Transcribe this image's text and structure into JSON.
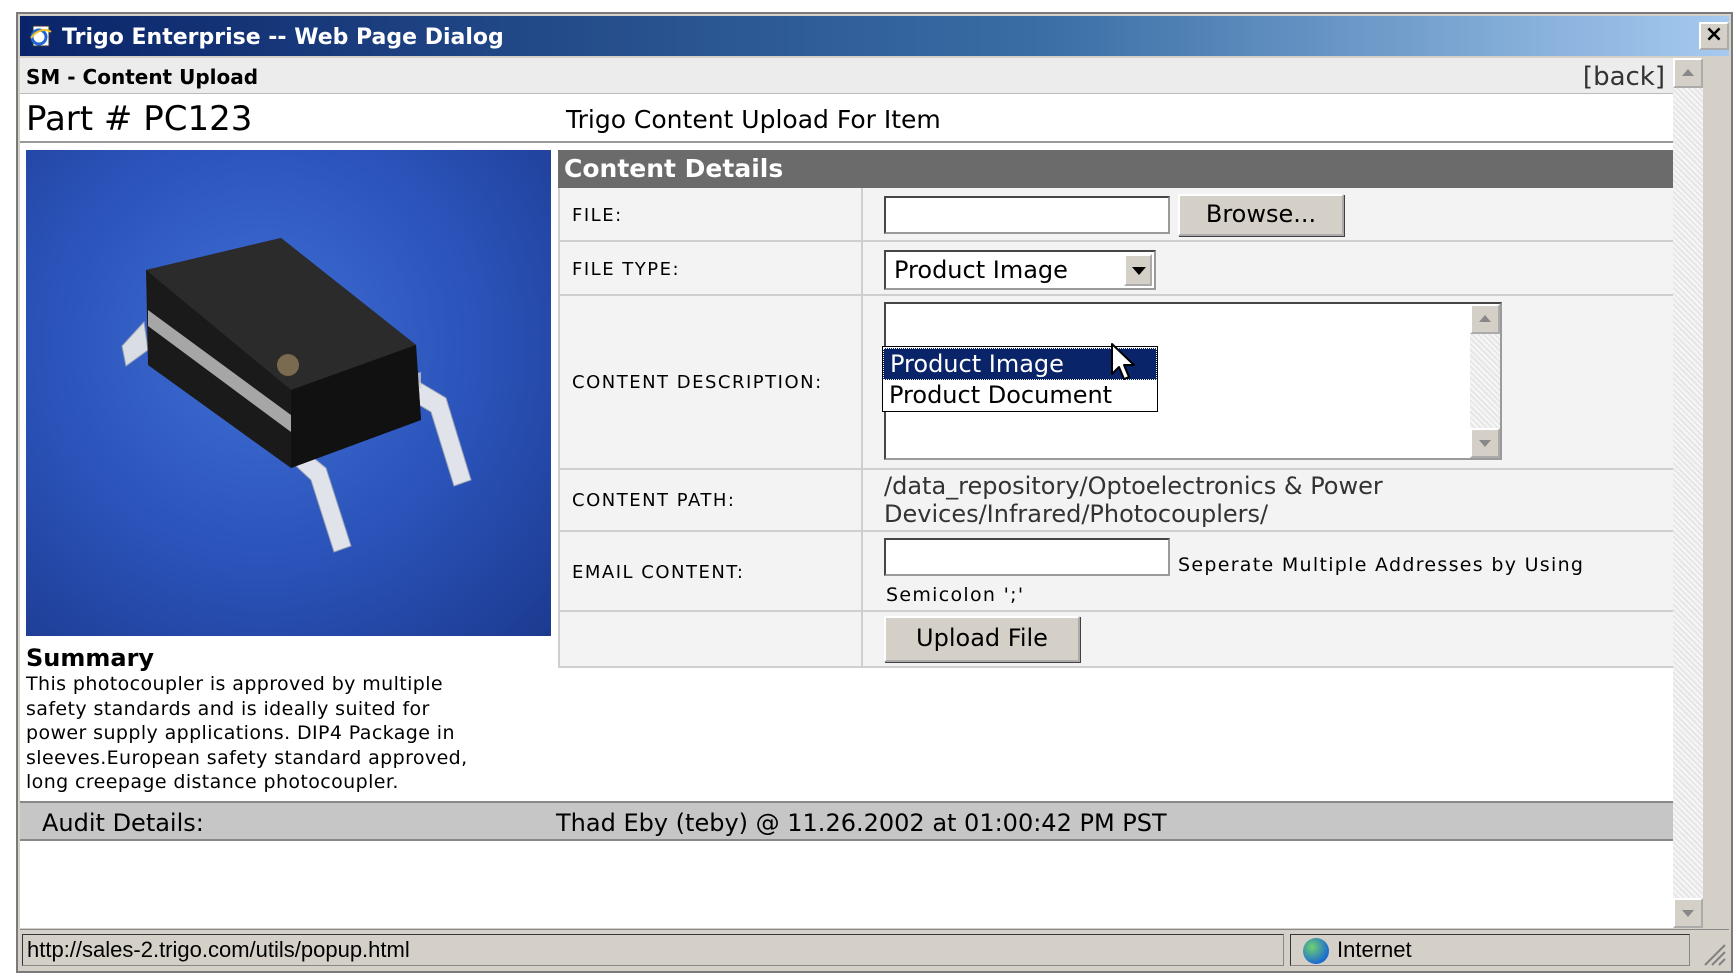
{
  "window": {
    "title": "Trigo Enterprise -- Web Page Dialog",
    "close_label": "×"
  },
  "header": {
    "section_title": "SM - Content Upload",
    "back_label": "[back]"
  },
  "part": {
    "number": "Part # PC123",
    "upload_heading": "Trigo Content Upload For Item"
  },
  "summary": {
    "title": "Summary",
    "lines": [
      "This photocoupler is approved by multiple",
      "safety standards and is ideally suited for",
      "power supply applications. DIP4 Package in",
      "sleeves.European safety standard approved,",
      "long creepage distance photocoupler."
    ]
  },
  "details": {
    "header": "Content Details",
    "file_label": "FILE:",
    "file_value": "",
    "browse_label": "Browse...",
    "file_type_label": "FILE TYPE:",
    "file_type_selected": "Product Image",
    "file_type_options": [
      "Product Image",
      "Product Document"
    ],
    "description_label": "CONTENT DESCRIPTION:",
    "description_value": "",
    "path_label": "CONTENT PATH:",
    "path_line1": "/data_repository/Optoelectronics & Power",
    "path_line2": "Devices/Infrared/Photocouplers/",
    "email_label": "EMAIL CONTENT:",
    "email_value": "",
    "email_note_1": "Seperate Multiple Addresses by Using",
    "email_note_2": "Semicolon ';'",
    "upload_label": "Upload File"
  },
  "audit": {
    "label": "Audit Details:",
    "value": "Thad Eby (teby) @ 11.26.2002 at 01:00:42 PM PST"
  },
  "status": {
    "url": "http://sales-2.trigo.com/utils/popup.html",
    "zone": "Internet"
  },
  "icons": {
    "app": "ie-document-icon",
    "zone": "globe-icon",
    "resize": "resize-grip-icon",
    "cursor": "mouse-pointer-icon"
  },
  "colors": {
    "titlebar_start": "#0a246a",
    "titlebar_end": "#a6caf0",
    "details_header": "#6b6b6b",
    "selection": "#0a246a",
    "photo_background": "#2a52b8"
  }
}
